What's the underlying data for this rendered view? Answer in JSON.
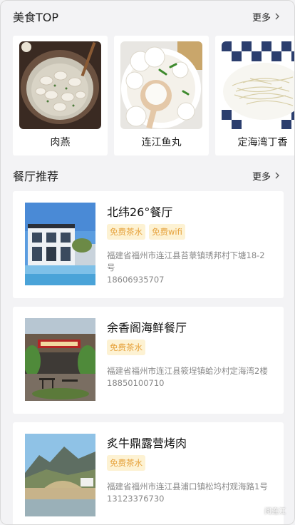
{
  "top_section": {
    "title": "美食TOP",
    "more_label": "更多"
  },
  "foods": [
    {
      "name": "肉燕",
      "image_icon": "dumpling-soup-photo"
    },
    {
      "name": "连江鱼丸",
      "image_icon": "fish-ball-soup-photo"
    },
    {
      "name": "定海湾丁香",
      "image_icon": "dried-fish-photo"
    }
  ],
  "restaurant_section": {
    "title": "餐厅推荐",
    "more_label": "更多"
  },
  "restaurants": [
    {
      "name": "北纬26°餐厅",
      "tags": [
        "免费茶水",
        "免费wifi"
      ],
      "address": "福建省福州市连江县苔菉镇琇邦村下塘18-2号",
      "phone": "18606935707"
    },
    {
      "name": "余香阁海鲜餐厅",
      "tags": [
        "免费茶水"
      ],
      "address": "福建省福州市连江县筱埕镇蛤沙村定海湾2楼",
      "phone": "18850100710"
    },
    {
      "name": "炙牛鼎露营烤肉",
      "tags": [
        "免费茶水"
      ],
      "address": "福建省福州市连江县浦口镇松坞村观海路1号",
      "phone": "13123376730"
    }
  ],
  "watermark": {
    "text": "阅连江"
  },
  "colors": {
    "background": "#f3f3f5",
    "card": "#ffffff",
    "tag_bg": "#fdf2d3",
    "tag_text": "#e6a23c",
    "muted_text": "#888888"
  }
}
